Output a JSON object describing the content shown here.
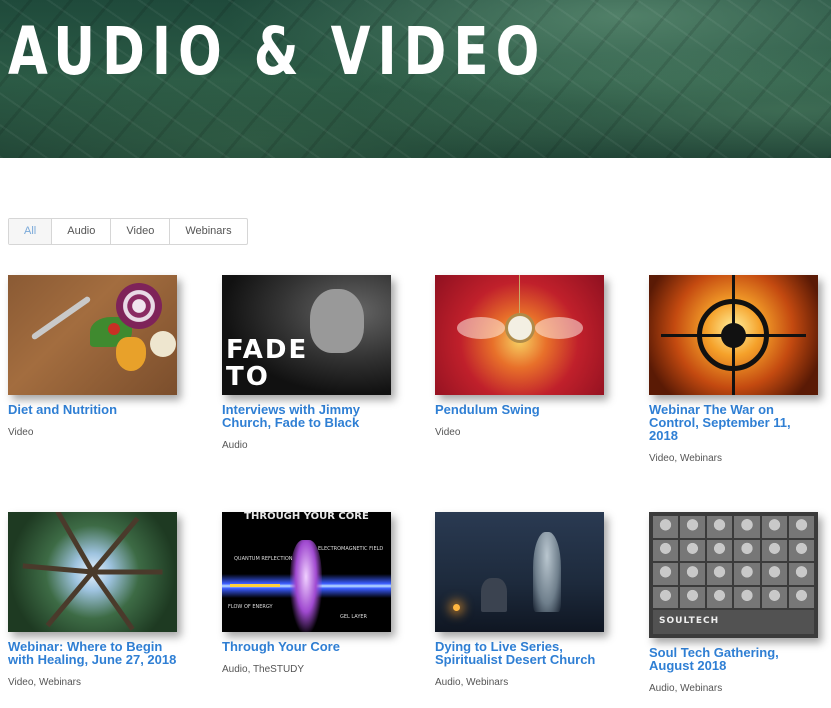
{
  "hero": {
    "title": "AUDIO & VIDEO"
  },
  "filters": [
    {
      "label": "All",
      "active": true
    },
    {
      "label": "Audio",
      "active": false
    },
    {
      "label": "Video",
      "active": false
    },
    {
      "label": "Webinars",
      "active": false
    }
  ],
  "items": [
    {
      "title": "Diet and Nutrition",
      "categories": "Video",
      "thumb": "vegetables-on-wood"
    },
    {
      "title": "Interviews with Jimmy Church, Fade to Black",
      "categories": "Audio",
      "thumb": "fade-to-black-logo",
      "thumb_text": [
        "FADE",
        "TO"
      ]
    },
    {
      "title": "Pendulum Swing",
      "categories": "Video",
      "thumb": "pocket-watch-with-wings"
    },
    {
      "title": "Webinar The War on Control, September 11, 2018",
      "categories": "Video, Webinars",
      "thumb": "crosshair-over-fire"
    },
    {
      "title": "Webinar: Where to Begin with Healing, June 27, 2018",
      "categories": "Video, Webinars",
      "thumb": "forest-canopy"
    },
    {
      "title": "Through Your Core",
      "categories": "Audio, TheSTUDY",
      "thumb": "energy-body-diagram",
      "thumb_text": [
        "THROUGH YOUR CORE",
        "QUANTUM REFLECTION",
        "ELECTROMAGNETIC FIELD",
        "FLOW OF ENERGY",
        "GEL LAYER"
      ]
    },
    {
      "title": "Dying to Live Series, Spiritualist Desert Church",
      "categories": "Audio, Webinars",
      "thumb": "graveyard-ghost"
    },
    {
      "title": "Soul Tech Gathering, August 2018",
      "categories": "Audio, Webinars",
      "thumb": "speaker-portrait-grid",
      "thumb_text": [
        "SOULTECH"
      ]
    }
  ],
  "colors": {
    "link": "#2f7fd4",
    "active_filter": "#7aa9d9"
  }
}
